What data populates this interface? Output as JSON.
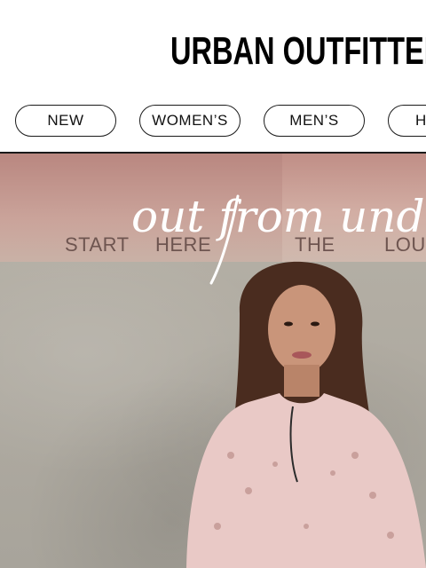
{
  "header": {
    "logo_text": "URBAN OUTFITTERS"
  },
  "nav": {
    "items": [
      {
        "label": "NEW"
      },
      {
        "label": "WOMEN’S"
      },
      {
        "label": "MEN’S"
      },
      {
        "label": "HOME"
      }
    ]
  },
  "hero": {
    "script_text": "out from under",
    "words": [
      "START",
      "HERE",
      "THE",
      "LOUD"
    ],
    "colors": {
      "wall_top": "#c08e86",
      "wall_bottom": "#a8a49b",
      "text": "#6e5550",
      "script": "#ffffff"
    }
  }
}
